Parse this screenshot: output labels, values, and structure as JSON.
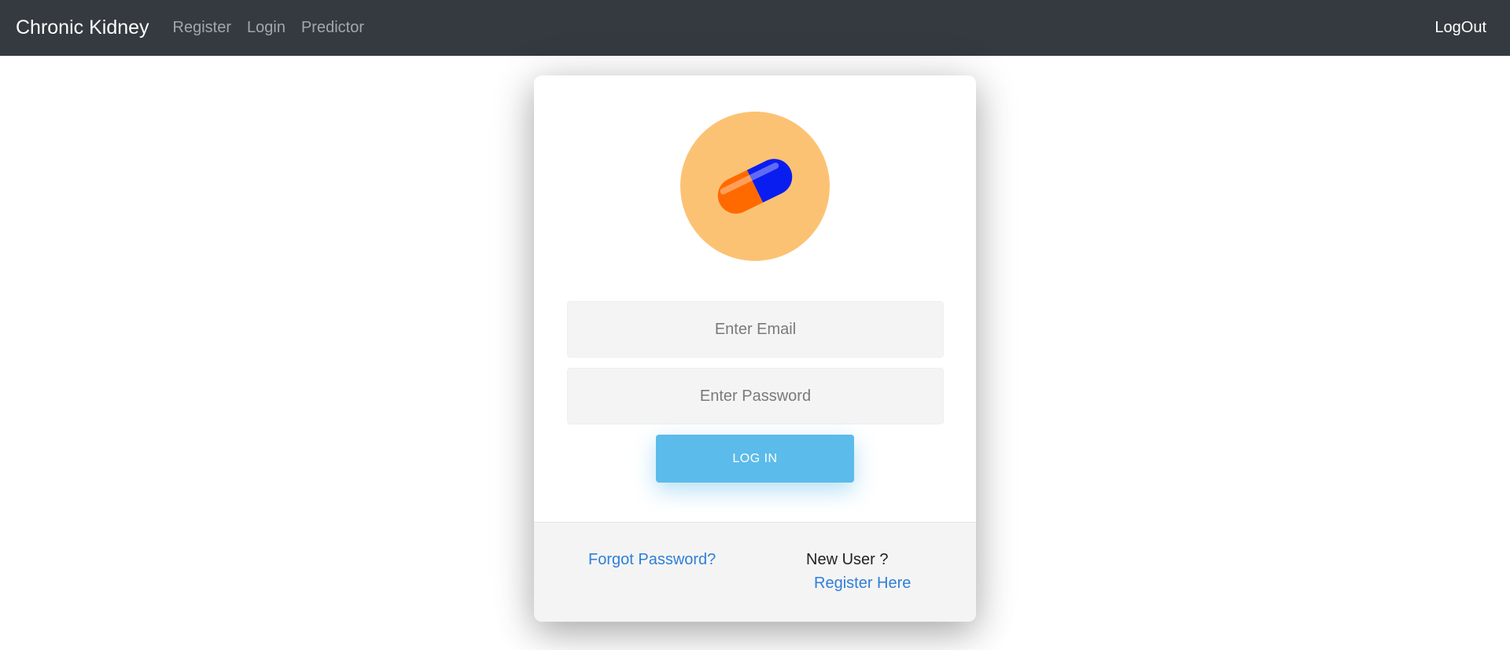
{
  "navbar": {
    "brand": "Chronic Kidney",
    "links": [
      "Register",
      "Login",
      "Predictor"
    ],
    "logout": "LogOut",
    "background": "#343a40"
  },
  "login_card": {
    "logo": {
      "icon": "capsule-pill-icon",
      "circle_color": "#fcc273",
      "pill_colors": [
        "#ff6a00",
        "#0a1df0"
      ]
    },
    "email_placeholder": "Enter Email",
    "password_placeholder": "Enter Password",
    "login_button": "LOG IN",
    "button_color": "#5bbbea",
    "footer": {
      "forgot_password": "Forgot Password?",
      "new_user": "New User ?",
      "register_here": "Register Here",
      "link_color": "#2f7fd8"
    }
  }
}
